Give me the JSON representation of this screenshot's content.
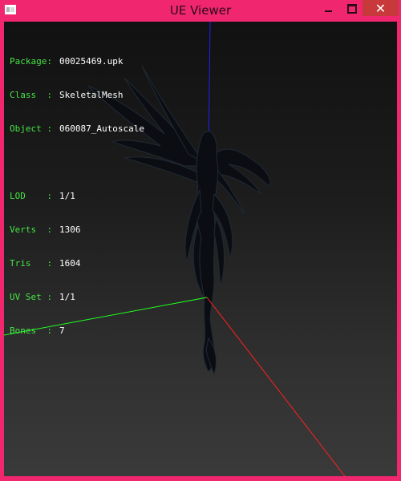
{
  "window": {
    "title": "UE Viewer",
    "controls": {
      "minimize": "",
      "maximize": "",
      "close": "✕"
    }
  },
  "info": {
    "group1": [
      {
        "label": "Package:",
        "value": "00025469.upk"
      },
      {
        "label": "Class  :",
        "value": "SkeletalMesh"
      },
      {
        "label": "Object :",
        "value": "060087_Autoscale"
      }
    ],
    "group2": [
      {
        "label": "LOD    :",
        "value": "1/1"
      },
      {
        "label": "Verts  :",
        "value": "1306"
      },
      {
        "label": "Tris   :",
        "value": "1604"
      },
      {
        "label": "UV Set :",
        "value": "1/1"
      },
      {
        "label": "Bones  :",
        "value": "7"
      }
    ]
  },
  "scene": {
    "axis_colors": {
      "x": "#ff2020",
      "y": "#20ff20",
      "z": "#2020ff"
    },
    "mesh_color": "#0b0d12",
    "mesh_highlight": "#1f2a35",
    "background_top": "#111111",
    "background_bottom": "#3a3a3a"
  }
}
